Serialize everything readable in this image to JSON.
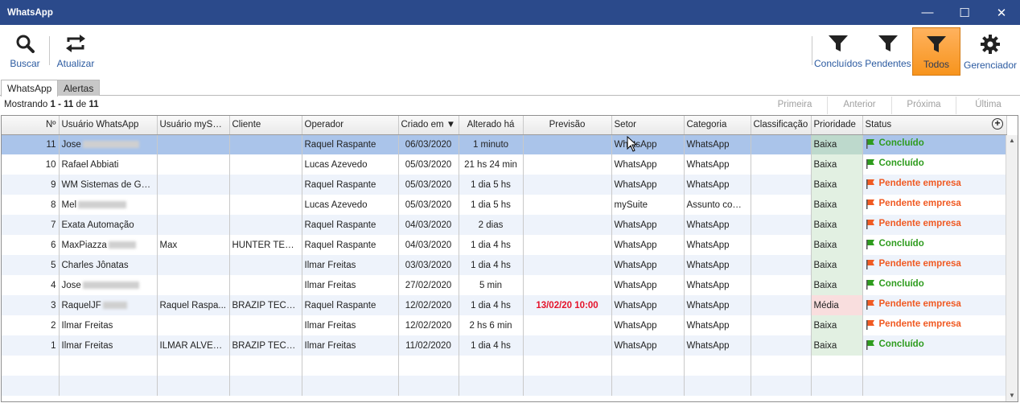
{
  "window": {
    "title": "WhatsApp"
  },
  "toolbar": {
    "buscar": "Buscar",
    "atualizar": "Atualizar",
    "concluidos": "Concluídos",
    "pendentes": "Pendentes",
    "todos": "Todos",
    "gerenciador": "Gerenciador"
  },
  "tabs": {
    "whatsapp": "WhatsApp",
    "alertas": "Alertas"
  },
  "info": {
    "prefix": "Mostrando ",
    "range": "1 - 11",
    "of": " de ",
    "total": "11"
  },
  "pager": {
    "first": "Primeira",
    "prev": "Anterior",
    "next": "Próxima",
    "last": "Última"
  },
  "columns": {
    "num": "Nº",
    "user": "Usuário WhatsApp",
    "mysuite": "Usuário mySuite",
    "cliente": "Cliente",
    "operador": "Operador",
    "criado": "Criado em ▼",
    "alterado": "Alterado há",
    "previsao": "Previsão",
    "setor": "Setor",
    "categoria": "Categoria",
    "classificacao": "Classificação",
    "prioridade": "Prioridade",
    "status": "Status"
  },
  "rows": [
    {
      "num": "11",
      "user": "Jose",
      "mysuite": "",
      "cliente": "",
      "operador": "Raquel Raspante",
      "criado": "06/03/2020",
      "alterado": "1 minuto",
      "previsao": "",
      "setor": "WhatsApp",
      "categoria": "WhatsApp",
      "prioridade": "Baixa",
      "status": "Concluído"
    },
    {
      "num": "10",
      "user": "Rafael Abbiati",
      "mysuite": "",
      "cliente": "",
      "operador": "Lucas Azevedo",
      "criado": "05/03/2020",
      "alterado": "21 hs 24 min",
      "previsao": "",
      "setor": "WhatsApp",
      "categoria": "WhatsApp",
      "prioridade": "Baixa",
      "status": "Concluído"
    },
    {
      "num": "9",
      "user": "WM Sistemas de Ges...",
      "mysuite": "",
      "cliente": "",
      "operador": "Raquel Raspante",
      "criado": "05/03/2020",
      "alterado": "1 dia 5 hs",
      "previsao": "",
      "setor": "WhatsApp",
      "categoria": "WhatsApp",
      "prioridade": "Baixa",
      "status": "Pendente empresa"
    },
    {
      "num": "8",
      "user": "Mel",
      "mysuite": "",
      "cliente": "",
      "operador": "Lucas Azevedo",
      "criado": "05/03/2020",
      "alterado": "1 dia 5 hs",
      "previsao": "",
      "setor": "mySuite",
      "categoria": "Assunto com...",
      "prioridade": "Baixa",
      "status": "Pendente empresa"
    },
    {
      "num": "7",
      "user": "Exata Automação",
      "mysuite": "",
      "cliente": "",
      "operador": "Raquel Raspante",
      "criado": "04/03/2020",
      "alterado": "2 dias",
      "previsao": "",
      "setor": "WhatsApp",
      "categoria": "WhatsApp",
      "prioridade": "Baixa",
      "status": "Pendente empresa"
    },
    {
      "num": "6",
      "user": "MaxPiazza",
      "mysuite": "Max",
      "cliente": "HUNTER TECN...",
      "operador": "Raquel Raspante",
      "criado": "04/03/2020",
      "alterado": "1 dia 4 hs",
      "previsao": "",
      "setor": "WhatsApp",
      "categoria": "WhatsApp",
      "prioridade": "Baixa",
      "status": "Concluído"
    },
    {
      "num": "5",
      "user": "Charles Jônatas",
      "mysuite": "",
      "cliente": "",
      "operador": "Ilmar Freitas",
      "criado": "03/03/2020",
      "alterado": "1 dia 4 hs",
      "previsao": "",
      "setor": "WhatsApp",
      "categoria": "WhatsApp",
      "prioridade": "Baixa",
      "status": "Pendente empresa"
    },
    {
      "num": "4",
      "user": "Jose",
      "mysuite": "",
      "cliente": "",
      "operador": "Ilmar Freitas",
      "criado": "27/02/2020",
      "alterado": "5 min",
      "previsao": "",
      "setor": "WhatsApp",
      "categoria": "WhatsApp",
      "prioridade": "Baixa",
      "status": "Concluído"
    },
    {
      "num": "3",
      "user": "RaquelJF",
      "mysuite": "Raquel Raspa...",
      "cliente": "BRAZIP TECNO...",
      "operador": "Raquel Raspante",
      "criado": "12/02/2020",
      "alterado": "1 dia 4 hs",
      "previsao": "13/02/20 10:00",
      "setor": "WhatsApp",
      "categoria": "WhatsApp",
      "prioridade": "Média",
      "status": "Pendente empresa"
    },
    {
      "num": "2",
      "user": "Ilmar Freitas",
      "mysuite": "",
      "cliente": "",
      "operador": "Ilmar Freitas",
      "criado": "12/02/2020",
      "alterado": "2 hs 6 min",
      "previsao": "",
      "setor": "WhatsApp",
      "categoria": "WhatsApp",
      "prioridade": "Baixa",
      "status": "Pendente empresa"
    },
    {
      "num": "1",
      "user": "Ilmar Freitas",
      "mysuite": "ILMAR ALVES ...",
      "cliente": "BRAZIP TECNO...",
      "operador": "Ilmar Freitas",
      "criado": "11/02/2020",
      "alterado": "1 dia 4 hs",
      "previsao": "",
      "setor": "WhatsApp",
      "categoria": "WhatsApp",
      "prioridade": "Baixa",
      "status": "Concluído"
    }
  ],
  "colors": {
    "titlebar": "#2b4a8b",
    "accent": "#f7941d",
    "ok": "#2e9c1e",
    "pending": "#f05a23",
    "selected_row": "#aac4ea"
  }
}
